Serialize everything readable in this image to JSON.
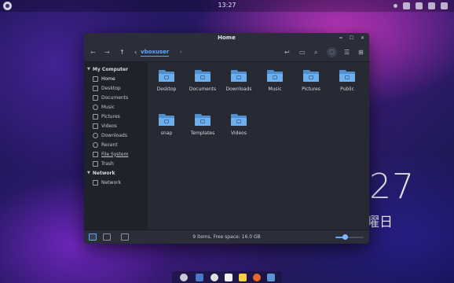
{
  "topbar": {
    "clock": "13:27"
  },
  "desktop": {
    "clock": "27",
    "day": "曜日"
  },
  "window": {
    "title": "Home",
    "breadcrumb": {
      "location": "vboxuser"
    },
    "sidebar": {
      "sections": [
        {
          "label": "My Computer",
          "items": [
            {
              "label": "Home",
              "icon": "home-icon"
            },
            {
              "label": "Desktop",
              "icon": "desktop-icon"
            },
            {
              "label": "Documents",
              "icon": "documents-icon"
            },
            {
              "label": "Music",
              "icon": "music-icon"
            },
            {
              "label": "Pictures",
              "icon": "pictures-icon"
            },
            {
              "label": "Videos",
              "icon": "videos-icon"
            },
            {
              "label": "Downloads",
              "icon": "downloads-icon"
            },
            {
              "label": "Recent",
              "icon": "recent-icon"
            },
            {
              "label": "File System",
              "icon": "filesystem-icon"
            },
            {
              "label": "Trash",
              "icon": "trash-icon"
            }
          ]
        },
        {
          "label": "Network",
          "items": [
            {
              "label": "Network",
              "icon": "network-icon"
            }
          ]
        }
      ]
    },
    "files": [
      {
        "name": "Desktop"
      },
      {
        "name": "Documents"
      },
      {
        "name": "Downloads"
      },
      {
        "name": "Music"
      },
      {
        "name": "Pictures"
      },
      {
        "name": "Public"
      },
      {
        "name": "snap"
      },
      {
        "name": "Templates"
      },
      {
        "name": "Videos"
      }
    ],
    "status": {
      "text": "9 items, Free space: 16.0 GB",
      "zoom_level": 0.35
    }
  },
  "colors": {
    "accent": "#5fa8ff",
    "folder": "#6fb0ec",
    "window_bg": "#23252e"
  }
}
